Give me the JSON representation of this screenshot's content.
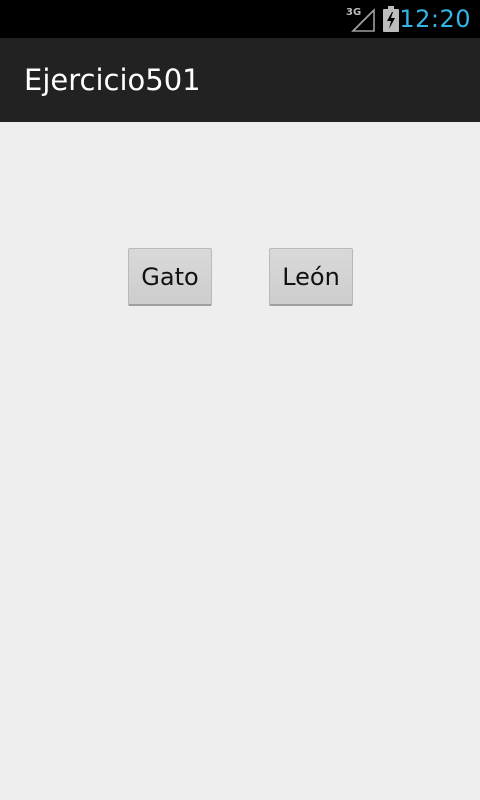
{
  "status_bar": {
    "network_label": "3G",
    "time": "12:20",
    "clock_color": "#33b5e5",
    "icons": [
      "signal-3g-icon",
      "battery-charging-icon"
    ]
  },
  "action_bar": {
    "title": "Ejercicio501",
    "background": "#222222"
  },
  "main": {
    "buttons": [
      {
        "label": "Gato"
      },
      {
        "label": "León"
      }
    ]
  }
}
